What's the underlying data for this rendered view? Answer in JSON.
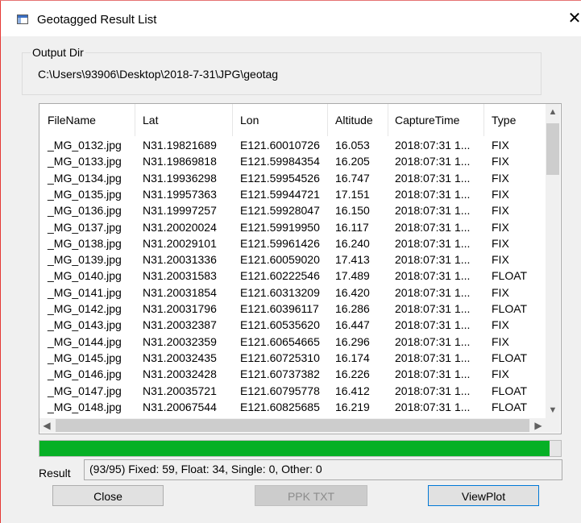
{
  "window": {
    "title": "Geotagged Result List",
    "close_glyph": "✕"
  },
  "output_dir": {
    "legend": "Output Dir",
    "path": "C:\\Users\\93906\\Desktop\\2018-7-31\\JPG\\geotag"
  },
  "table": {
    "columns": [
      "FileName",
      "Lat",
      "Lon",
      "Altitude",
      "CaptureTime",
      "Type"
    ],
    "rows": [
      [
        "_MG_0132.jpg",
        "N31.19821689",
        "E121.60010726",
        "16.053",
        "2018:07:31 1...",
        "FIX"
      ],
      [
        "_MG_0133.jpg",
        "N31.19869818",
        "E121.59984354",
        "16.205",
        "2018:07:31 1...",
        "FIX"
      ],
      [
        "_MG_0134.jpg",
        "N31.19936298",
        "E121.59954526",
        "16.747",
        "2018:07:31 1...",
        "FIX"
      ],
      [
        "_MG_0135.jpg",
        "N31.19957363",
        "E121.59944721",
        "17.151",
        "2018:07:31 1...",
        "FIX"
      ],
      [
        "_MG_0136.jpg",
        "N31.19997257",
        "E121.59928047",
        "16.150",
        "2018:07:31 1...",
        "FIX"
      ],
      [
        "_MG_0137.jpg",
        "N31.20020024",
        "E121.59919950",
        "16.117",
        "2018:07:31 1...",
        "FIX"
      ],
      [
        "_MG_0138.jpg",
        "N31.20029101",
        "E121.59961426",
        "16.240",
        "2018:07:31 1...",
        "FIX"
      ],
      [
        "_MG_0139.jpg",
        "N31.20031336",
        "E121.60059020",
        "17.413",
        "2018:07:31 1...",
        "FIX"
      ],
      [
        "_MG_0140.jpg",
        "N31.20031583",
        "E121.60222546",
        "17.489",
        "2018:07:31 1...",
        "FLOAT"
      ],
      [
        "_MG_0141.jpg",
        "N31.20031854",
        "E121.60313209",
        "16.420",
        "2018:07:31 1...",
        "FIX"
      ],
      [
        "_MG_0142.jpg",
        "N31.20031796",
        "E121.60396117",
        "16.286",
        "2018:07:31 1...",
        "FLOAT"
      ],
      [
        "_MG_0143.jpg",
        "N31.20032387",
        "E121.60535620",
        "16.447",
        "2018:07:31 1...",
        "FIX"
      ],
      [
        "_MG_0144.jpg",
        "N31.20032359",
        "E121.60654665",
        "16.296",
        "2018:07:31 1...",
        "FIX"
      ],
      [
        "_MG_0145.jpg",
        "N31.20032435",
        "E121.60725310",
        "16.174",
        "2018:07:31 1...",
        "FLOAT"
      ],
      [
        "_MG_0146.jpg",
        "N31.20032428",
        "E121.60737382",
        "16.226",
        "2018:07:31 1...",
        "FIX"
      ],
      [
        "_MG_0147.jpg",
        "N31.20035721",
        "E121.60795778",
        "16.412",
        "2018:07:31 1...",
        "FLOAT"
      ],
      [
        "_MG_0148.jpg",
        "N31.20067544",
        "E121.60825685",
        "16.219",
        "2018:07:31 1...",
        "FLOAT"
      ]
    ]
  },
  "progress": {
    "fraction": 0.979,
    "color": "#06b025"
  },
  "result": {
    "label": "Result",
    "text": "(93/95) Fixed: 59, Float: 34, Single: 0, Other: 0"
  },
  "buttons": {
    "close": "Close",
    "ppk_txt": "PPK TXT",
    "view_plot": "ViewPlot"
  },
  "icons": [
    "app-window-icon",
    "close-icon",
    "scroll-up-icon",
    "scroll-down-icon",
    "scroll-left-icon",
    "scroll-right-icon"
  ]
}
